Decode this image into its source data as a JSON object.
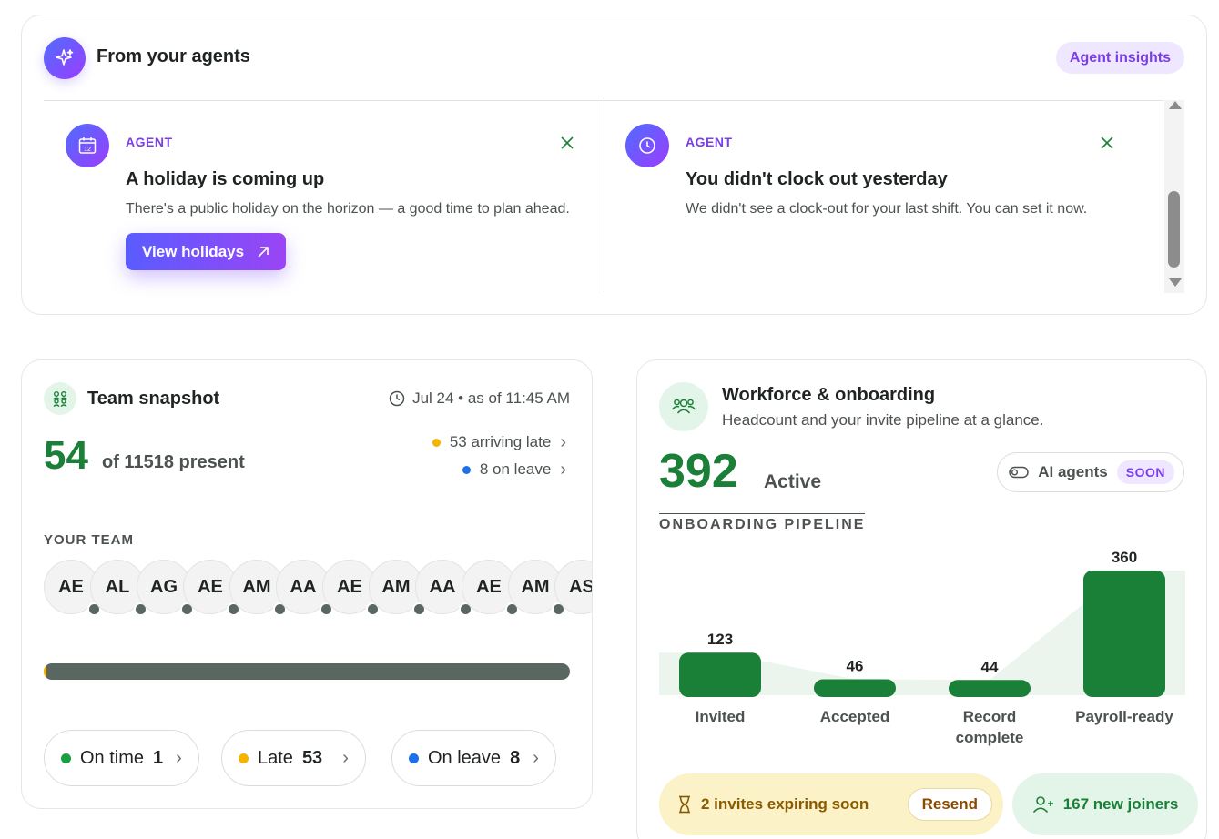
{
  "agents": {
    "title": "From your agents",
    "insights_label": "Agent insights",
    "items": [
      {
        "tag": "AGENT",
        "icon": "calendar-icon",
        "icon_text": "12",
        "title": "A holiday is coming up",
        "description": "There's a public holiday on the horizon — a good time to plan ahead.",
        "action_label": "View holidays"
      },
      {
        "tag": "AGENT",
        "icon": "clock-icon",
        "title": "You didn't clock out yesterday",
        "description": "We didn't see a clock-out for your last shift. You can set it now."
      }
    ]
  },
  "team": {
    "title": "Team snapshot",
    "date": "Jul 24 • as of 11:45 AM",
    "present_count": "54",
    "present_label": "of 11518 present",
    "late_text": "53 arriving late",
    "leave_text": "8 on leave",
    "your_team_label": "YOUR TEAM",
    "avatars": [
      "AE",
      "AL",
      "AG",
      "AE",
      "AM",
      "AA",
      "AE",
      "AM",
      "AA",
      "AE",
      "AM",
      "AS"
    ],
    "bar": {
      "late_fraction": 0.005
    },
    "chips": [
      {
        "label": "On time",
        "value": "1",
        "color": "#1a9e3f"
      },
      {
        "label": "Late",
        "value": "53",
        "color": "#f4b400"
      },
      {
        "label": "On leave",
        "value": "8",
        "color": "#1f6feb"
      }
    ],
    "colors": {
      "late": "#f4b400",
      "leave": "#1f6feb",
      "present": "#1a7f37",
      "bar": "#5a6660"
    }
  },
  "workforce": {
    "title": "Workforce & onboarding",
    "subtitle": "Headcount and your invite pipeline at a glance.",
    "active_count": "392",
    "active_label": "Active",
    "ai_label": "AI agents",
    "soon_label": "SOON",
    "pipeline_label": "ONBOARDING PIPELINE",
    "expiring_text": "2 invites expiring soon",
    "resend_label": "Resend",
    "joiners_text": "167 new joiners"
  },
  "chart_data": {
    "type": "bar",
    "categories": [
      "Invited",
      "Accepted",
      "Record complete",
      "Payroll-ready"
    ],
    "category_lines": [
      [
        "Invited"
      ],
      [
        "Accepted"
      ],
      [
        "Record",
        "complete"
      ],
      [
        "Payroll-ready"
      ]
    ],
    "values": [
      123,
      46,
      44,
      360
    ],
    "data_labels": [
      "123",
      "46",
      "44",
      "360"
    ],
    "ylim": [
      0,
      360
    ],
    "grid": false,
    "bar_color": "#1a7f37",
    "area_color": "#e6f2ea"
  }
}
